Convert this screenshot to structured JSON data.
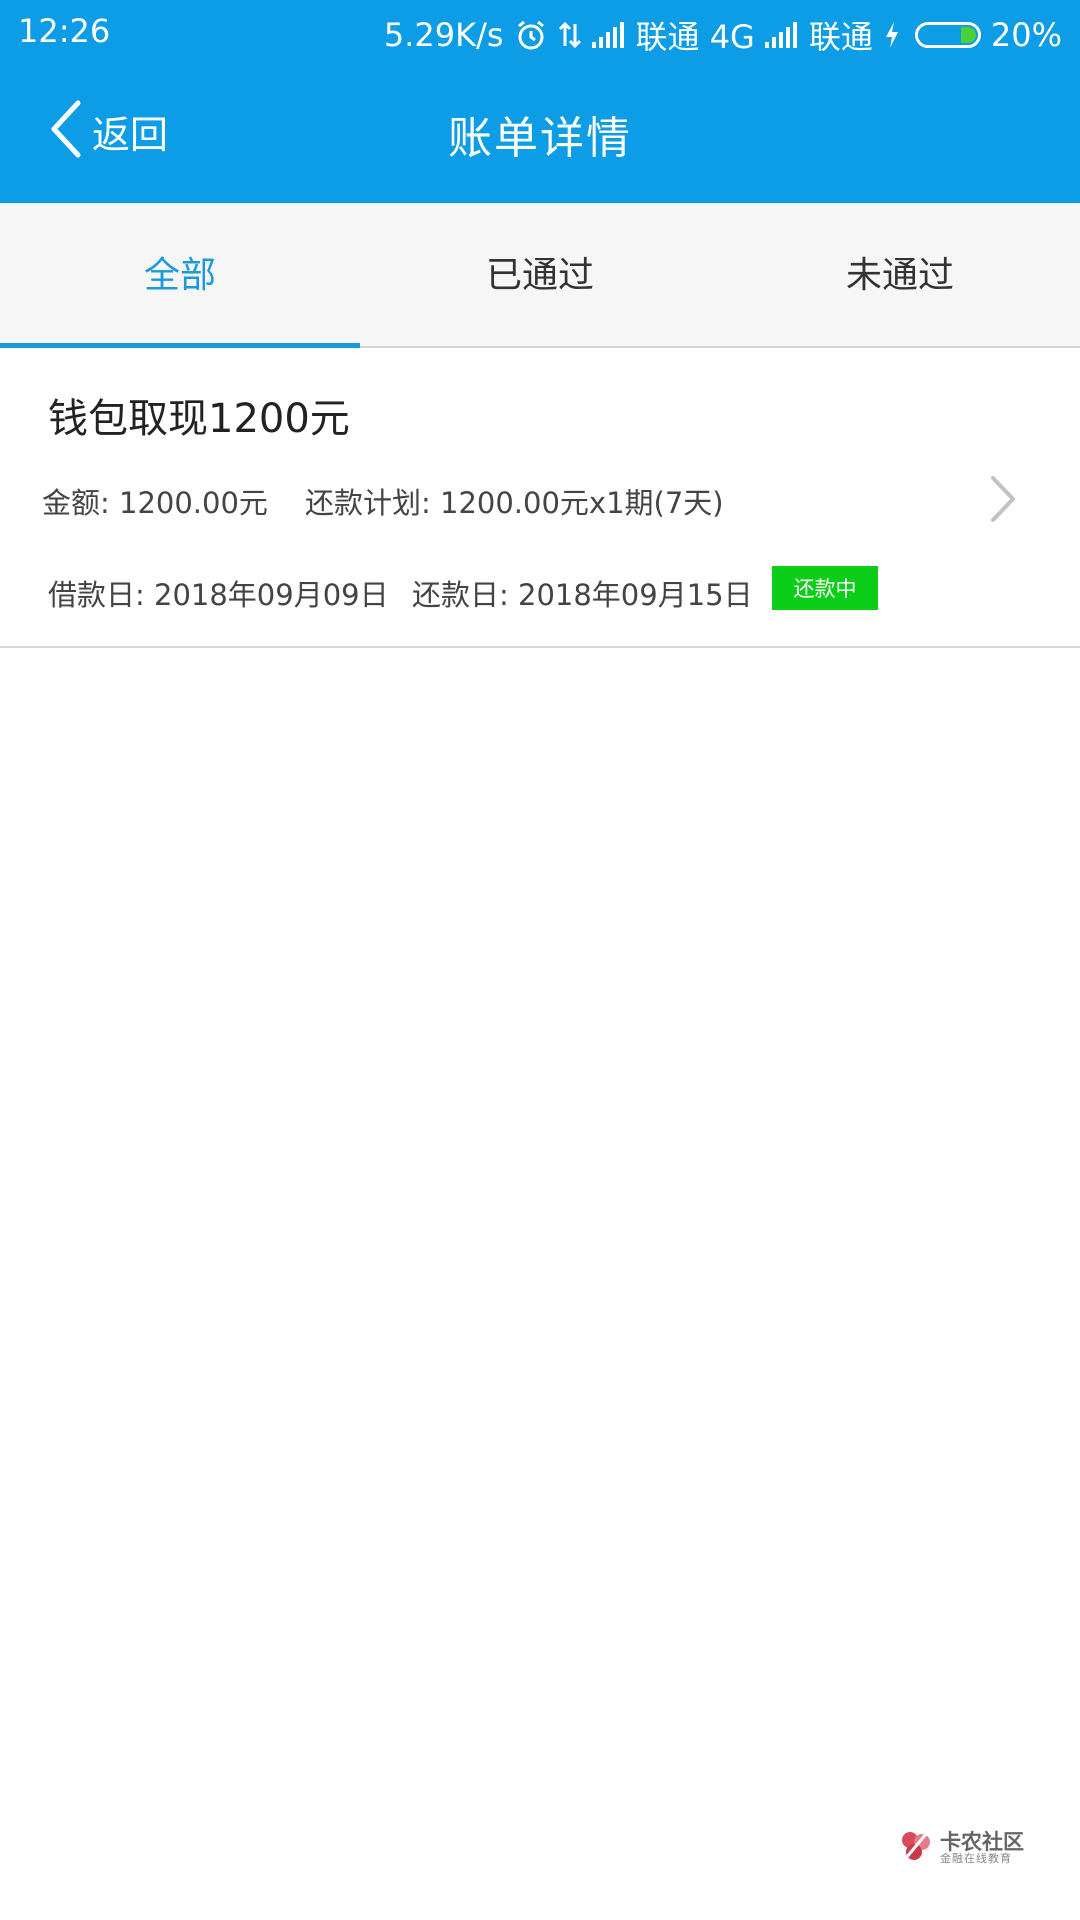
{
  "status_bar": {
    "time": "12:26",
    "speed": "5.29K/s",
    "carrier1": "联通 4G",
    "carrier2": "联通",
    "battery": "20%"
  },
  "header": {
    "back_label": "返回",
    "title": "账单详情",
    "color": "#0c9de6"
  },
  "tabs": [
    {
      "label": "全部",
      "active": true
    },
    {
      "label": "已通过",
      "active": false
    },
    {
      "label": "未通过",
      "active": false
    }
  ],
  "records": [
    {
      "title": "钱包取现1200元",
      "amount": "金额: 1200.00元",
      "plan": "还款计划: 1200.00元x1期(7天)",
      "borrow_date": "借款日: 2018年09月09日",
      "repay_date": "还款日: 2018年09月15日",
      "status": "还款中",
      "status_color": "#0cce18"
    }
  ],
  "watermark": {
    "brand": "卡农社区",
    "subtitle": "金融在线教育"
  },
  "colors": {
    "accent": "#1a9bd9"
  }
}
